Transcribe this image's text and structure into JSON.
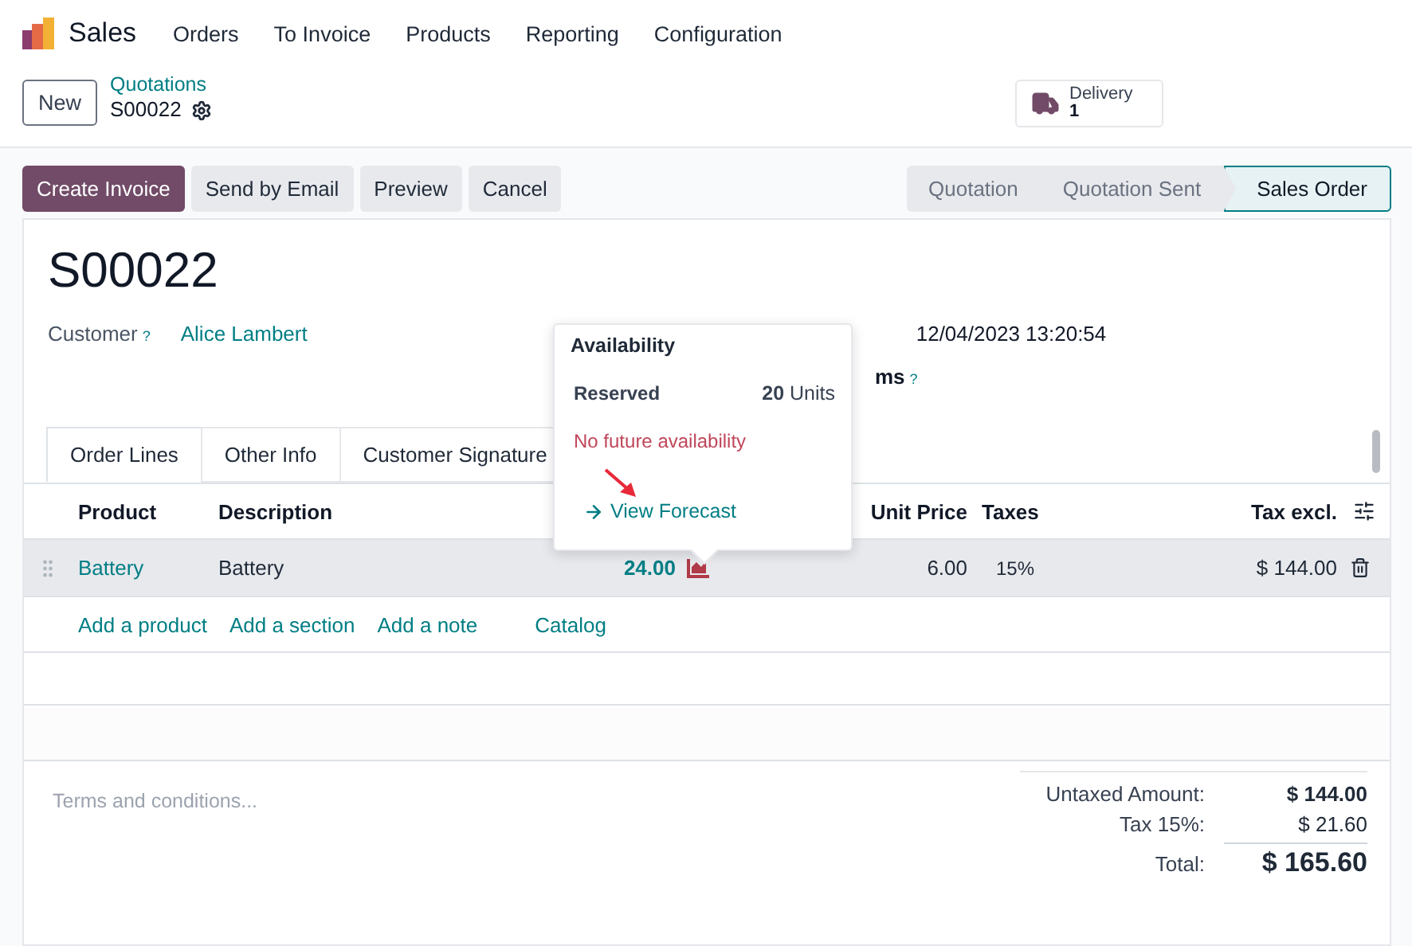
{
  "app": {
    "name": "Sales"
  },
  "menu": [
    "Orders",
    "To Invoice",
    "Products",
    "Reporting",
    "Configuration"
  ],
  "breadcrumb": {
    "new_button": "New",
    "parent": "Quotations",
    "current": "S00022"
  },
  "smart_button": {
    "label": "Delivery",
    "count": "1"
  },
  "actions": [
    {
      "label": "Create Invoice",
      "primary": true
    },
    {
      "label": "Send by Email",
      "primary": false
    },
    {
      "label": "Preview",
      "primary": false
    },
    {
      "label": "Cancel",
      "primary": false
    }
  ],
  "stages": [
    {
      "label": "Quotation",
      "selected": false
    },
    {
      "label": "Quotation Sent",
      "selected": false
    },
    {
      "label": "Sales Order",
      "selected": true
    }
  ],
  "form": {
    "title": "S00022",
    "customer_label": "Customer",
    "customer_help": "?",
    "customer": "Alice Lambert",
    "date": "12/04/2023 13:20:54",
    "payment_terms_label": "ms",
    "payment_terms_help": "?"
  },
  "tabs": [
    {
      "label": "Order Lines",
      "selected": true
    },
    {
      "label": "Other Info",
      "selected": false
    },
    {
      "label": "Customer Signature",
      "selected": false
    }
  ],
  "table": {
    "columns": [
      "Product",
      "Description",
      "Unit Price",
      "Taxes",
      "Tax excl."
    ],
    "rows": [
      {
        "product": "Battery",
        "description": "Battery",
        "quantity": "24.00",
        "unit_price": "6.00",
        "taxes": "15%",
        "subtotal": "$ 144.00",
        "selected": true
      }
    ],
    "add_links": [
      "Add a product",
      "Add a section",
      "Add a note",
      "Catalog"
    ]
  },
  "popover": {
    "title": "Availability",
    "reserved_label": "Reserved",
    "reserved_qty": "20",
    "reserved_unit": "Units",
    "warning": "No future availability",
    "link": "View Forecast"
  },
  "terms_placeholder": "Terms and conditions...",
  "totals": [
    {
      "label": "Untaxed Amount:",
      "value": "$ 144.00",
      "kind": "bold"
    },
    {
      "label": "Tax 15%:",
      "value": "$ 21.60",
      "kind": "normal"
    },
    {
      "label": "Total:",
      "value": "$ 165.60",
      "kind": "grand"
    }
  ]
}
